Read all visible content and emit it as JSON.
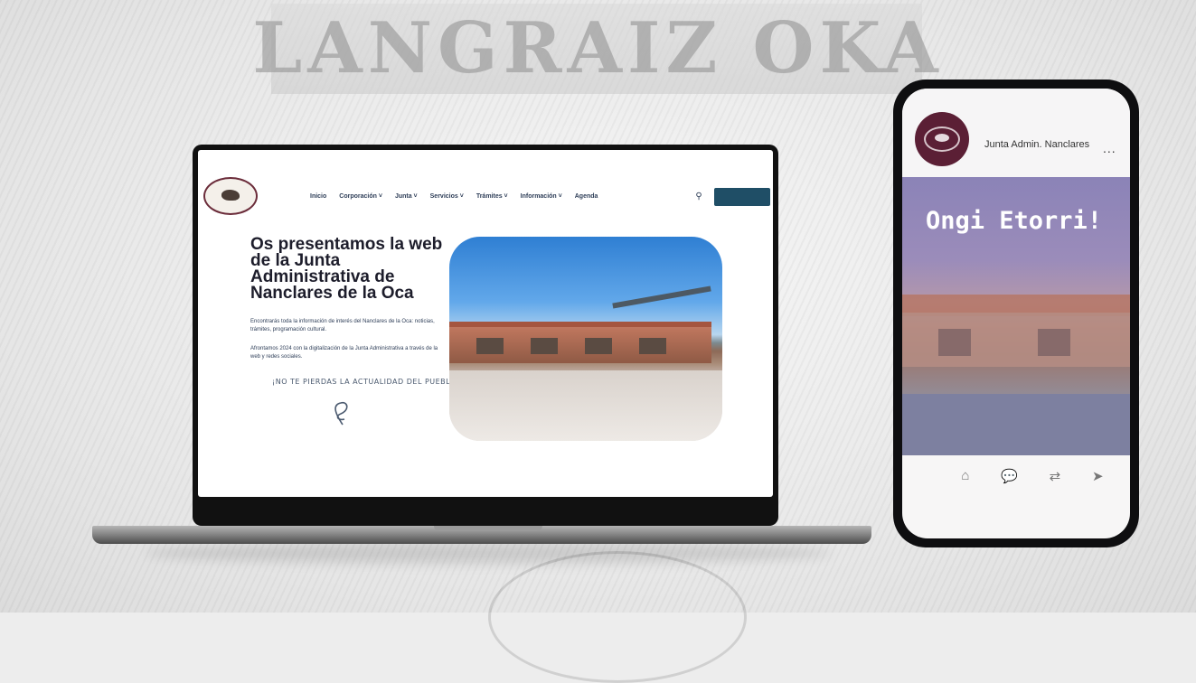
{
  "background": {
    "title": "LANGRAIZ OKA"
  },
  "laptop": {
    "nav": {
      "items": [
        "Inicio",
        "Corporación ˅",
        "Junta ˅",
        "Servicios ˅",
        "Trámites ˅",
        "Información ˅",
        "Agenda"
      ],
      "search_icon": "search-icon",
      "contact_label": ""
    },
    "hero": {
      "title": "Os presentamos la web de la Junta Administrativa de Nanclares de la Oca",
      "paragraph1": "Encontrarás toda la información de interés del Nanclares de la Oca: noticias, trámites, programación cultural.",
      "paragraph2": "Afrontamos 2024 con la digitalización de la Junta Administrativa a través de la web y redes sociales.",
      "handwriting": "¡NO TE PIERDAS LA ACTUALIDAD DEL PUEBLO!"
    }
  },
  "phone": {
    "account_name": "Junta Admin. Nanclares",
    "more": "...",
    "greeting": "Ongi Etorri!",
    "actions": [
      {
        "icon": "home-icon",
        "glyph": "⌂"
      },
      {
        "icon": "comment-icon",
        "glyph": "💬"
      },
      {
        "icon": "repost-icon",
        "glyph": "⇄"
      },
      {
        "icon": "send-icon",
        "glyph": "➤"
      }
    ]
  },
  "colors": {
    "brand": "#1f4e66",
    "burgundy": "#5b1f35",
    "text": "#2d3d57"
  }
}
